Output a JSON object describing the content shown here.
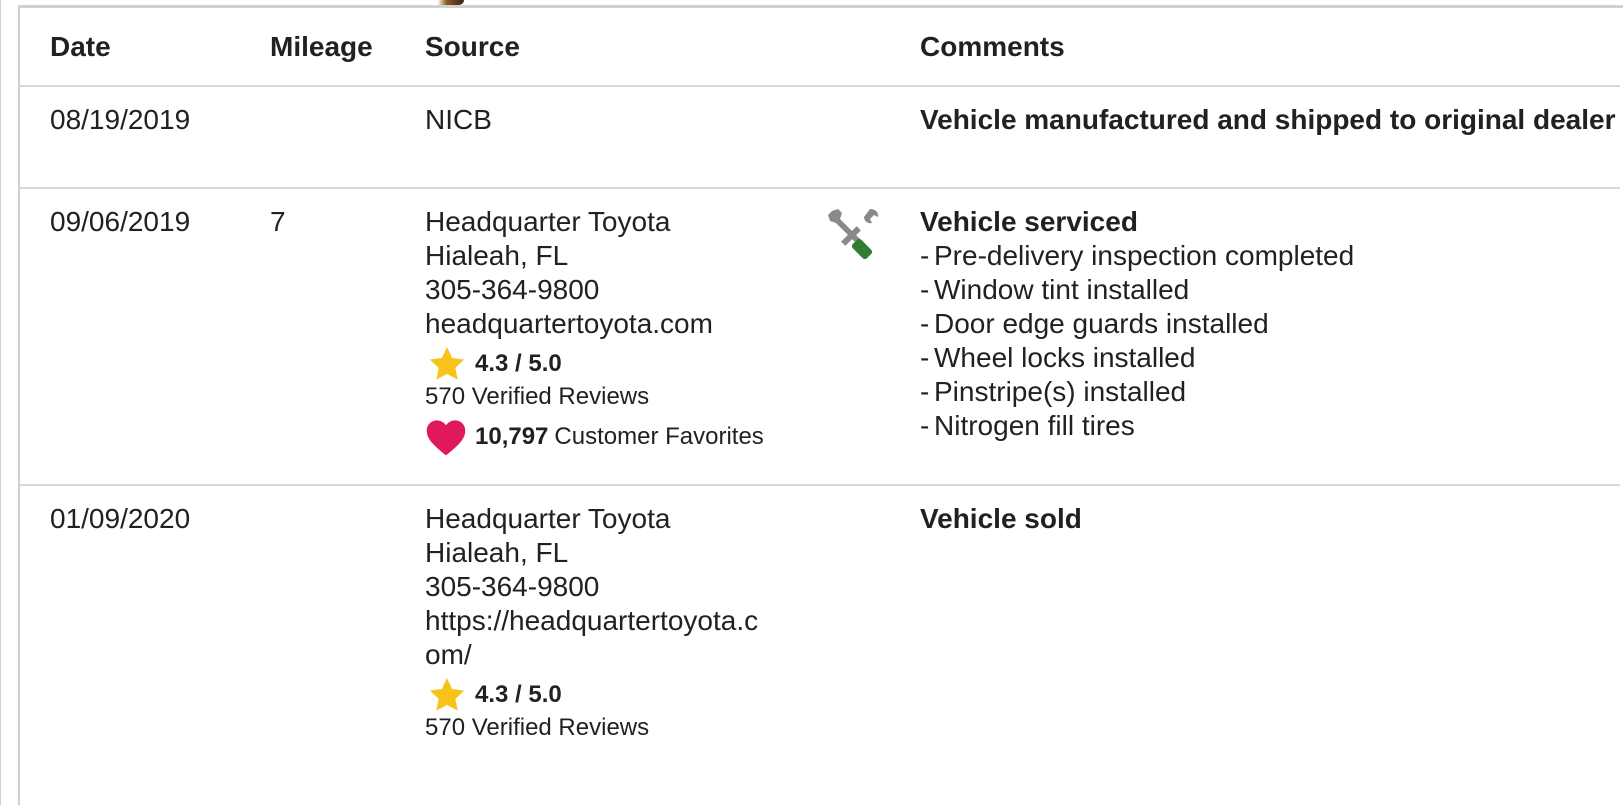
{
  "table": {
    "headers": {
      "date": "Date",
      "mileage": "Mileage",
      "source": "Source",
      "comments": "Comments"
    },
    "rows": [
      {
        "date": "08/19/2019",
        "mileage": "",
        "source": {
          "lines": [
            "NICB"
          ]
        },
        "icon": "",
        "comment_title": "Vehicle manufactured and shipped to original dealer",
        "comment_items": []
      },
      {
        "date": "09/06/2019",
        "mileage": "7",
        "source": {
          "lines": [
            "Headquarter Toyota",
            "Hialeah, FL",
            "305-364-9800",
            "headquartertoyota.com"
          ],
          "rating": "4.3 / 5.0",
          "reviews": "570 Verified Reviews",
          "favorites_count": "10,797",
          "favorites_label": "Customer Favorites"
        },
        "icon": "wrench-screwdriver-icon",
        "comment_title": "Vehicle serviced",
        "comment_items": [
          "Pre-delivery inspection completed",
          "Window tint installed",
          "Door edge guards installed",
          "Wheel locks installed",
          "Pinstripe(s) installed",
          "Nitrogen fill tires"
        ]
      },
      {
        "date": "01/09/2020",
        "mileage": "",
        "source": {
          "lines": [
            "Headquarter Toyota",
            "Hialeah, FL",
            "305-364-9800",
            "https://headquartertoyota.c",
            "om/"
          ],
          "rating": "4.3 / 5.0",
          "reviews": "570 Verified Reviews"
        },
        "icon": "",
        "comment_title": "Vehicle sold",
        "comment_items": []
      }
    ]
  },
  "colors": {
    "star": "#f9c21b",
    "heart": "#e0195f",
    "wrench": "#8a8a8a",
    "screwdriver_handle": "#2e7d32",
    "divider": "#d8d8d8"
  },
  "separator": "-"
}
